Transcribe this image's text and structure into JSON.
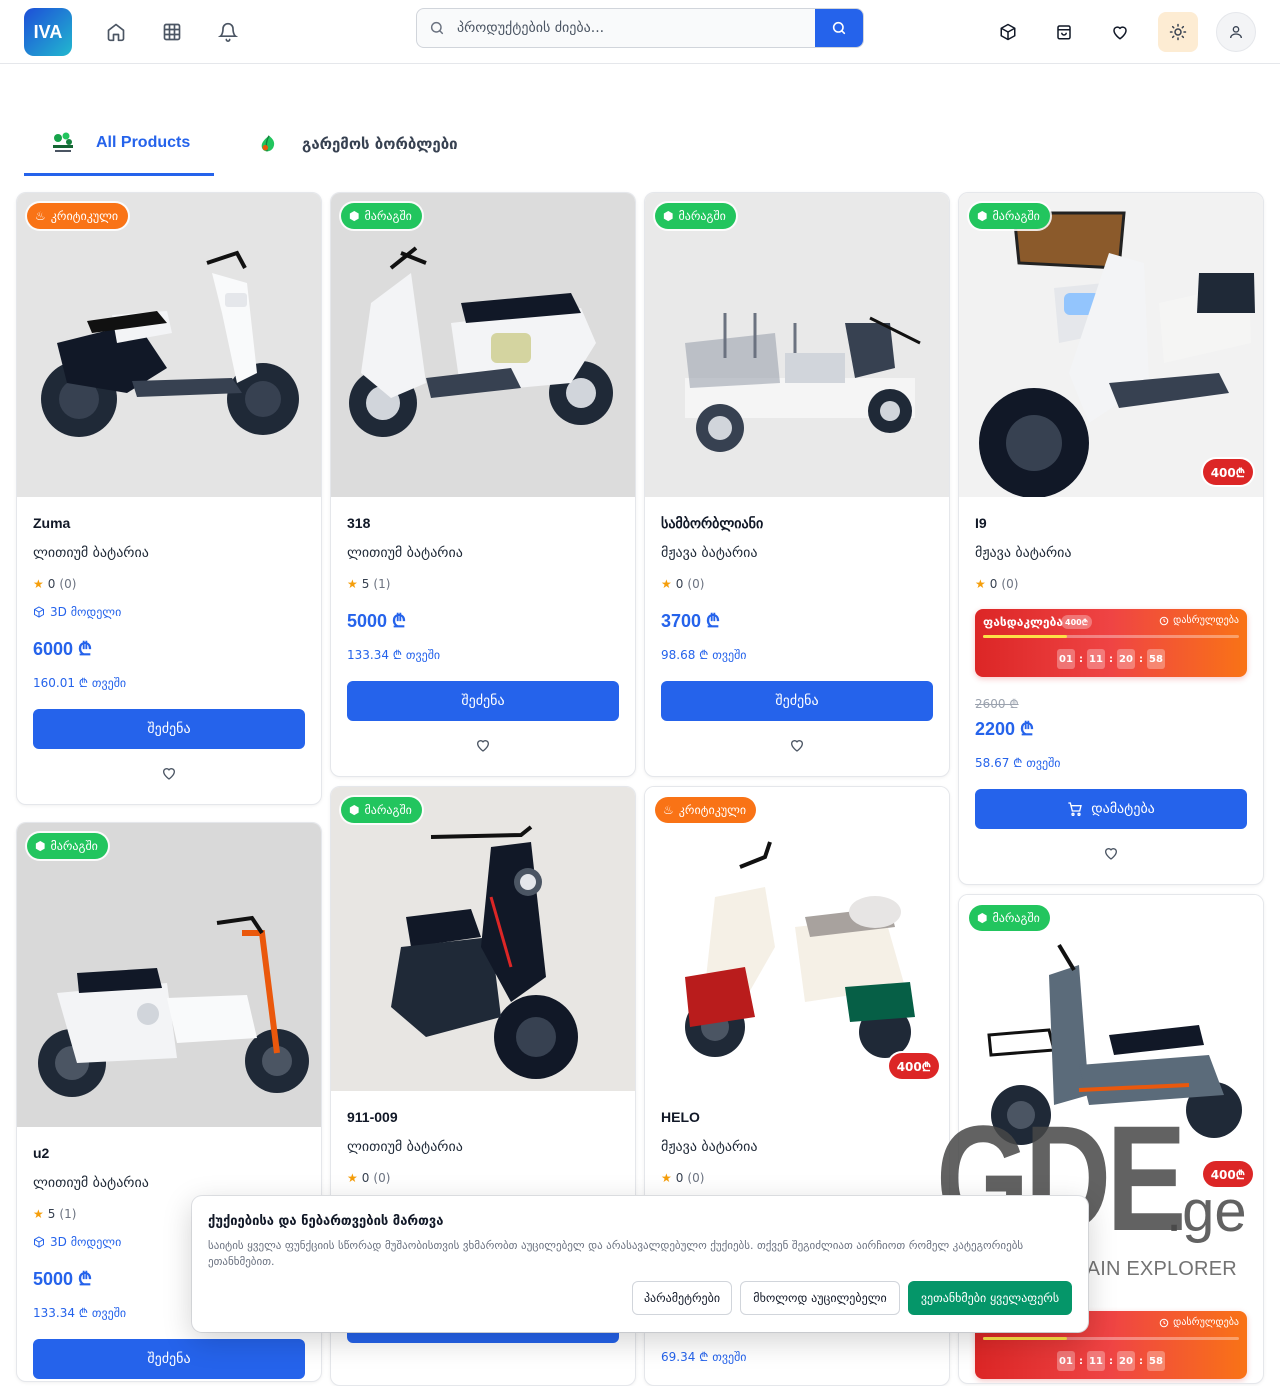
{
  "header": {
    "logo_text": "IVA",
    "search_placeholder": "პროდუქტების ძიება...",
    "nav_icons": [
      "home-icon",
      "grid-icon",
      "bell-icon"
    ],
    "action_icons": [
      "box-icon",
      "bag-icon",
      "heart-icon",
      "sun-icon",
      "user-icon"
    ]
  },
  "tabs": [
    {
      "label": "All Products",
      "active": true
    },
    {
      "label": "გარემოს ბორბლები",
      "active": false
    }
  ],
  "labels": {
    "buy": "შეძენა",
    "add": "დამატება",
    "model3d": "3D მოდელი",
    "flash_title": "ფასდაკლება",
    "flash_ends": "დასრულდება"
  },
  "products": [
    {
      "name": "Zuma",
      "battery": "ლითიუმ ბატარია",
      "badge": "კრიტიკული",
      "rating": "0",
      "reviews": "(0)",
      "price": "6000 ₾",
      "monthly": "160.01 ₾ თვეში"
    },
    {
      "name": "318",
      "battery": "ლითიუმ ბატარია",
      "badge": "მარაგში",
      "rating": "5",
      "reviews": "(1)",
      "price": "5000 ₾",
      "monthly": "133.34 ₾ თვეში"
    },
    {
      "name": "სამბორბლიანი",
      "battery": "მჟავა ბატარია",
      "badge": "მარაგში",
      "rating": "0",
      "reviews": "(0)",
      "price": "3700 ₾",
      "monthly": "98.68 ₾ თვეში"
    },
    {
      "name": "I9",
      "battery": "მჟავა ბატარია",
      "badge": "მარაგში",
      "rating": "0",
      "reviews": "(0)",
      "discount": "400₾",
      "flash_pill": "400₾",
      "timer": [
        "01",
        "11",
        "20",
        "58"
      ],
      "flash_progress": 0.33,
      "old_price": "2600 ₾",
      "price": "2200 ₾",
      "monthly": "58.67 ₾ თვეში"
    },
    {
      "name": "u2",
      "battery": "ლითიუმ ბატარია",
      "badge": "მარაგში",
      "rating": "5",
      "reviews": "(1)",
      "price": "5000 ₾",
      "monthly": "133.34 ₾ თვეში"
    },
    {
      "name": "911-009",
      "battery": "ლითიუმ ბატარია",
      "badge": "მარაგში",
      "rating": "0",
      "reviews": "(0)"
    },
    {
      "name": "HELO",
      "battery": "მჟავა ბატარია",
      "badge": "კრიტიკული",
      "rating": "0",
      "reviews": "(0)",
      "discount": "400₾",
      "monthly": "69.34 ₾ თვეში"
    },
    {
      "badge": "მარაგში",
      "discount": "400₾",
      "timer": [
        "01",
        "11",
        "20",
        "58"
      ]
    }
  ],
  "cookie": {
    "title": "ქუქიებისა და ნებართვების მართვა",
    "text": "საიტის ყველა ფუნქციის სწორად მუშაობისთვის ვხმარობთ აუცილებელ და არასავალდებულო ქუქიებს. თქვენ შეგიძლიათ აირჩიოთ რომელ კატეგორიებს ეთანხმებით.",
    "btn_settings": "პარამეტრები",
    "btn_necessary": "მხოლოდ აუცილებელი",
    "btn_accept": "ვეთანხმები ყველაფერს"
  },
  "watermark": {
    "logo": "GDE",
    "suffix": ".ge",
    "caption": "GEORGIA DOMAIN EXPLORER"
  },
  "colors": {
    "primary": "#2563eb",
    "instock": "#22c55e",
    "critical": "#f97316",
    "discount": "#dc2626",
    "accept": "#059669"
  }
}
